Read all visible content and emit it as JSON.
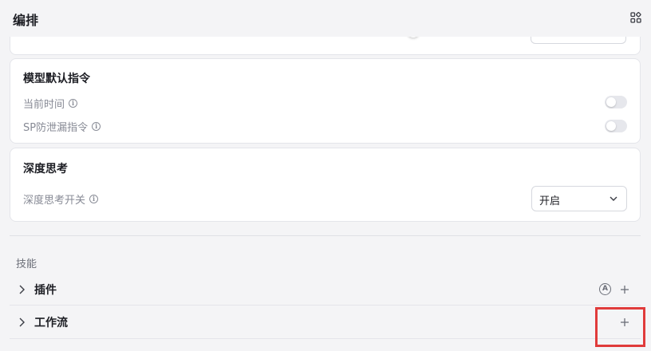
{
  "header": {
    "title": "编排",
    "apps_icon": "grid-apps-icon"
  },
  "model_instructions": {
    "title": "模型默认指令",
    "rows": [
      {
        "label": "当前时间",
        "enabled": false
      },
      {
        "label": "SP防泄漏指令",
        "enabled": false
      }
    ]
  },
  "deep_thinking": {
    "title": "深度思考",
    "switch_label": "深度思考开关",
    "switch_value": "开启"
  },
  "skills": {
    "label": "技能",
    "items": [
      {
        "label": "插件",
        "has_auto": true,
        "auto_glyph": "A"
      },
      {
        "label": "工作流",
        "has_auto": false
      }
    ]
  },
  "colors": {
    "background": "#f4f4f6",
    "card": "#ffffff",
    "highlight": "#e03b3b",
    "toggle_off": "#e6e7ec"
  }
}
